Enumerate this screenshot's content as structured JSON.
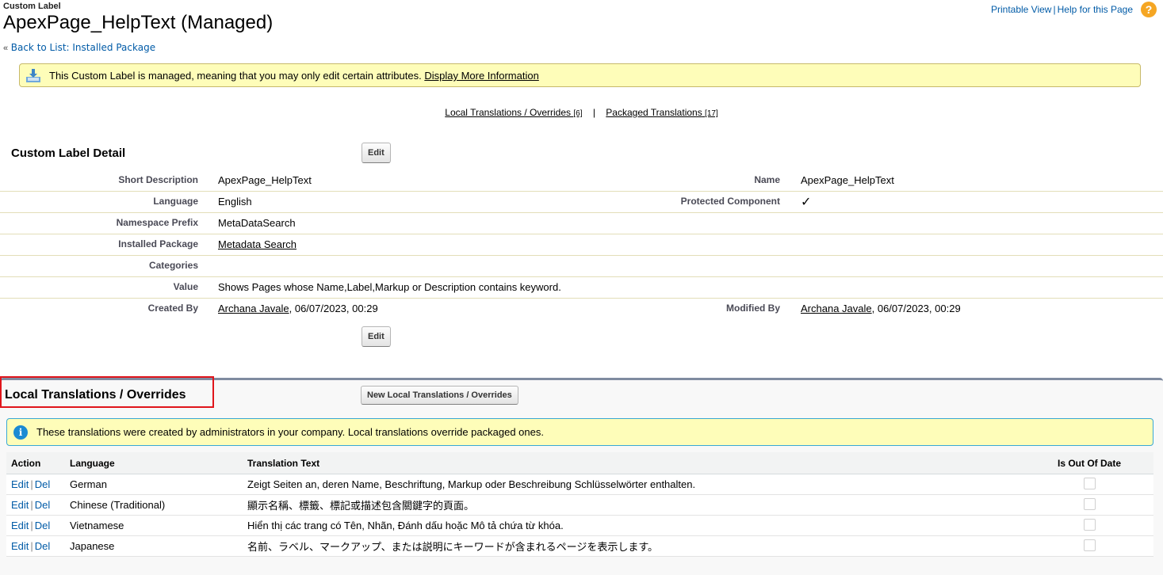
{
  "header": {
    "type_label": "Custom Label",
    "title": "ApexPage_HelpText (Managed)",
    "back_arrow": "«",
    "back_link": "Back to List: Installed Package",
    "printable_view": "Printable View",
    "link_separator": "|",
    "help_link": "Help for this Page",
    "help_icon": "?"
  },
  "managed_banner": {
    "message": "This Custom Label is managed, meaning that you may only edit certain attributes.",
    "link": "Display More Information"
  },
  "related_links": [
    {
      "label": "Local Translations / Overrides",
      "count": "[6]"
    },
    {
      "label": "Packaged Translations",
      "count": "[17]"
    }
  ],
  "related_separator": "|",
  "detail": {
    "title": "Custom Label Detail",
    "edit_label": "Edit",
    "fields": {
      "short_description": {
        "label": "Short Description",
        "value": "ApexPage_HelpText"
      },
      "name": {
        "label": "Name",
        "value": "ApexPage_HelpText"
      },
      "language": {
        "label": "Language",
        "value": "English"
      },
      "protected_component": {
        "label": "Protected Component",
        "value": "✓"
      },
      "namespace_prefix": {
        "label": "Namespace Prefix",
        "value": "MetaDataSearch"
      },
      "installed_package": {
        "label": "Installed Package",
        "value": "Metadata Search"
      },
      "categories": {
        "label": "Categories",
        "value": ""
      },
      "value": {
        "label": "Value",
        "value": "Shows Pages whose Name,Label,Markup or Description contains keyword."
      },
      "created_by": {
        "label": "Created By",
        "user": "Archana Javale",
        "date": ", 06/07/2023, 00:29"
      },
      "modified_by": {
        "label": "Modified By",
        "user": "Archana Javale",
        "date": ", 06/07/2023, 00:29"
      }
    }
  },
  "local_translations": {
    "title": "Local Translations / Overrides",
    "new_button": "New Local Translations / Overrides",
    "info_icon": "i",
    "info": "These translations were created by administrators in your company. Local translations override packaged ones.",
    "columns": [
      "Action",
      "Language",
      "Translation Text",
      "Is Out Of Date"
    ],
    "edit_label": "Edit",
    "del_label": "Del",
    "action_separator": "|",
    "rows": [
      {
        "language": "German",
        "text": "Zeigt Seiten an, deren Name, Beschriftung, Markup oder Beschreibung Schlüsselwörter enthalten.",
        "out_of_date": false
      },
      {
        "language": "Chinese (Traditional)",
        "text": "顯示名稱、標籤、標記或描述包含關鍵字的頁面。",
        "out_of_date": false
      },
      {
        "language": "Vietnamese",
        "text": "Hiển thị các trang có Tên, Nhãn, Đánh dấu hoặc Mô tả chứa từ khóa.",
        "out_of_date": false
      },
      {
        "language": "Japanese",
        "text": "名前、ラベル、マークアップ、または説明にキーワードが含まれるページを表示します。",
        "out_of_date": false
      }
    ]
  },
  "colors": {
    "link": "#015ba7",
    "banner_bg": "#fefdb9",
    "highlight_border": "#e0151b",
    "section_border": "#7f8ba0"
  }
}
